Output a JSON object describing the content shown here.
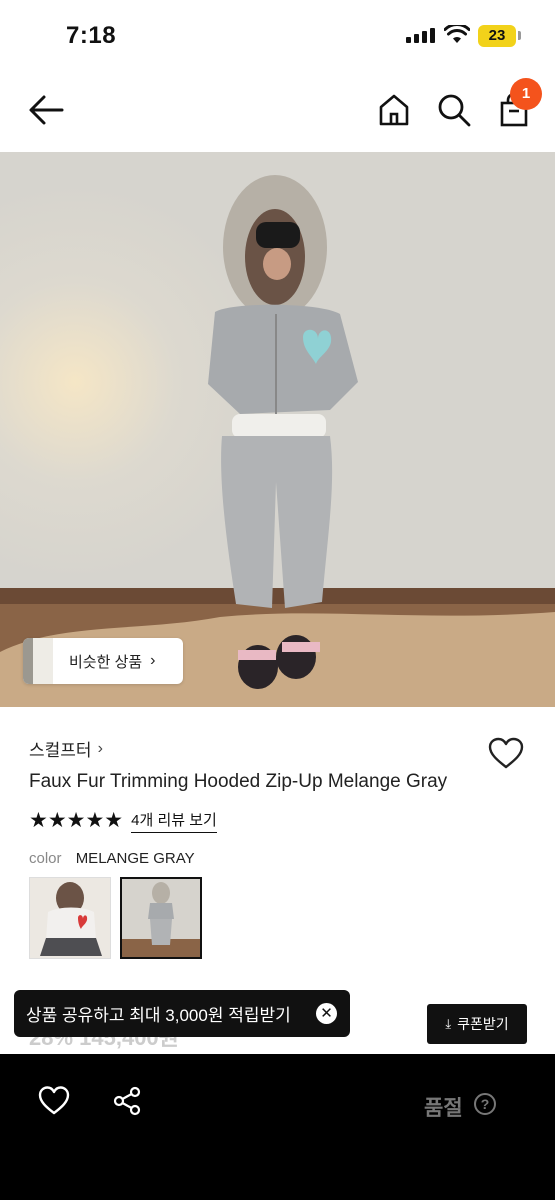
{
  "status_bar": {
    "time": "7:18",
    "battery": "23"
  },
  "nav": {
    "cart_count": "1",
    "icons": [
      "back-arrow-icon",
      "home-icon",
      "search-icon",
      "shopping-bag-icon"
    ]
  },
  "image": {
    "similar_button": "비슷한 상품",
    "chevron": "›"
  },
  "product": {
    "brand": "스컬프터",
    "brand_chevron": "›",
    "title": "Faux Fur Trimming Hooded Zip-Up Melange Gray",
    "rating_stars": "★★★★★",
    "rating_value": 5,
    "reviews_link": "4개 리뷰 보기",
    "color_label": "color",
    "color_value": "MELANGE GRAY",
    "price_partial": "28% 145,400원"
  },
  "toast": {
    "text": "상품 공유하고 최대 3,000원 적립받기",
    "close": "✕"
  },
  "coupon": {
    "icon": "⤓",
    "label": "쿠폰받기"
  },
  "bottom_bar": {
    "status": "품절",
    "help": "?"
  },
  "colors": {
    "badge": "#f4531c",
    "bottom_bar": "#000000",
    "sold_out_text": "#777777"
  }
}
